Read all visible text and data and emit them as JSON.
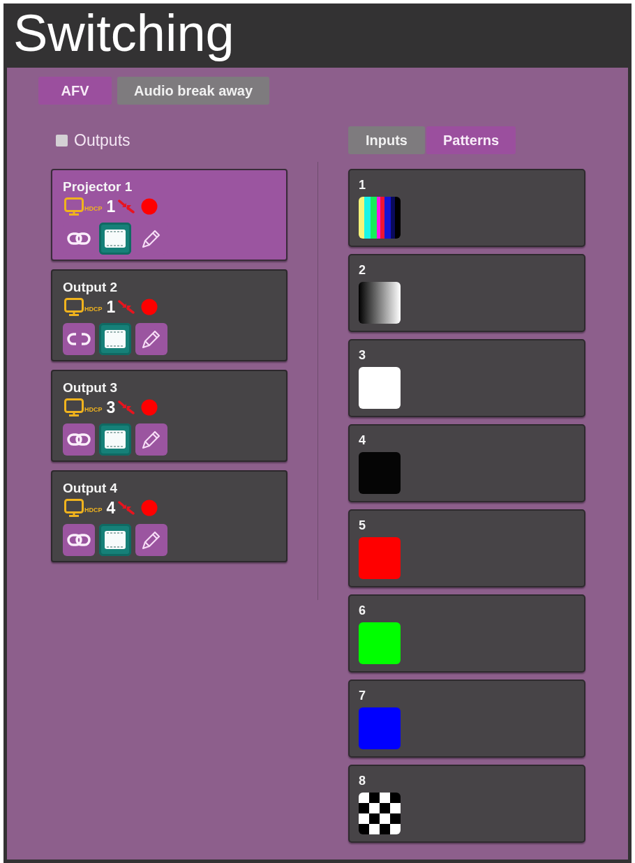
{
  "title": "Switching",
  "mode_tabs": [
    {
      "label": "AFV",
      "selected": true
    },
    {
      "label": "Audio break away",
      "selected": false
    }
  ],
  "outputs_toggle": {
    "label": "Outputs",
    "checked": false
  },
  "outputs": [
    {
      "name": "Projector 1",
      "selected": true,
      "hdcp": "HDCP",
      "input": "1",
      "linked": true
    },
    {
      "name": "Output 2",
      "selected": false,
      "hdcp": "HDCP",
      "input": "1",
      "linked": false
    },
    {
      "name": "Output 3",
      "selected": false,
      "hdcp": "HDCP",
      "input": "3",
      "linked": true
    },
    {
      "name": "Output 4",
      "selected": false,
      "hdcp": "HDCP",
      "input": "4",
      "linked": true
    }
  ],
  "source_tabs": [
    {
      "label": "Inputs",
      "selected": false
    },
    {
      "label": "Patterns",
      "selected": true
    }
  ],
  "patterns": [
    {
      "number": "1",
      "kind": "bars"
    },
    {
      "number": "2",
      "kind": "gradient"
    },
    {
      "number": "3",
      "kind": "solid",
      "color": "#ffffff"
    },
    {
      "number": "4",
      "kind": "solid",
      "color": "#050505"
    },
    {
      "number": "5",
      "kind": "solid",
      "color": "#ff0000"
    },
    {
      "number": "6",
      "kind": "solid",
      "color": "#00ff00"
    },
    {
      "number": "7",
      "kind": "solid",
      "color": "#0000ff"
    },
    {
      "number": "8",
      "kind": "checker"
    }
  ]
}
